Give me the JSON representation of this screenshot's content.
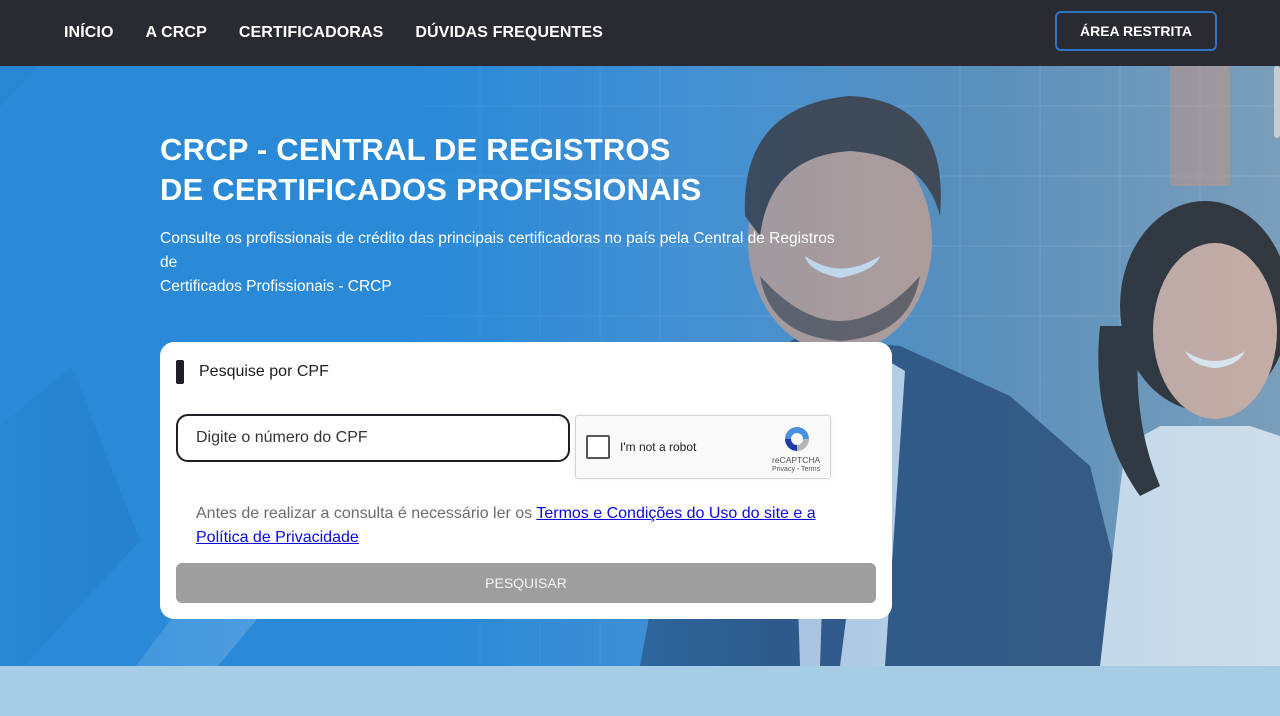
{
  "nav": {
    "items": [
      {
        "label": "INÍCIO"
      },
      {
        "label": "A CRCP"
      },
      {
        "label": "CERTIFICADORAS"
      },
      {
        "label": "DÚVIDAS FREQUENTES"
      }
    ],
    "restricted_label": "ÁREA RESTRITA"
  },
  "hero": {
    "title_line1": "CRCP - CENTRAL DE REGISTROS",
    "title_line2": "DE CERTIFICADOS PROFISSIONAIS",
    "subtitle_line1": "Consulte os profissionais de crédito das principais certificadoras no país pela Central de Registros",
    "subtitle_line2": "de",
    "subtitle_line3": "Certificados Profissionais - CRCP"
  },
  "search": {
    "heading": "Pesquise por CPF",
    "cpf_placeholder": "Digite o número do CPF",
    "terms_text": "Antes de realizar a consulta é necessário ler os ",
    "terms_link": "Termos e Condições do Uso do site e a Política de Privacidade",
    "button_label": "PESQUISAR"
  },
  "captcha": {
    "label": "I'm not a robot",
    "brand": "reCAPTCHA",
    "links": "Privacy - Terms",
    "icon": "recaptcha-icon"
  },
  "colors": {
    "nav_bg": "#2a2a33",
    "accent_border": "#2d74c4",
    "hero_blue": "#2a8ad8",
    "button_disabled": "#9e9e9e",
    "link": "#0a0ae0"
  }
}
